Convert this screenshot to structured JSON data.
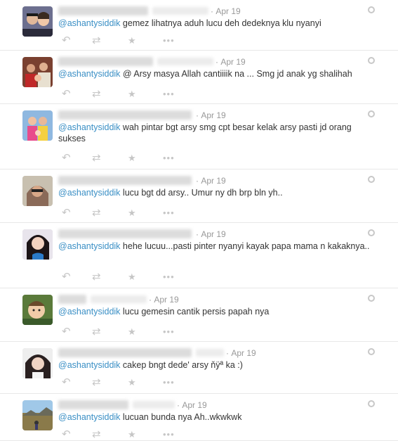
{
  "tweets": [
    {
      "date": "Apr 19",
      "mention": "@ashantysiddik",
      "text": " gemez lihatnya aduh lucu deh dedeknya klu nyanyi"
    },
    {
      "date": "Apr 19",
      "mention": "@ashantysiddik",
      "text": " @ Arsy masya Allah cantiiiik na ... Smg jd anak yg shalihah"
    },
    {
      "date": "Apr 19",
      "mention": "@ashantysiddik",
      "text": " wah pintar bgt arsy smg cpt besar kelak arsy pasti jd orang sukses"
    },
    {
      "date": "Apr 19",
      "mention": "@ashantysiddik",
      "text": " lucu bgt dd arsy.. Umur ny dh brp bln yh.."
    },
    {
      "date": "Apr 19",
      "mention": "@ashantysiddik",
      "text": " hehe lucuu...pasti pinter nyanyi kayak papa mama n kakaknya.."
    },
    {
      "date": "Apr 19",
      "mention": "@ashantysiddik",
      "text": " lucu gemesin cantik persis papah nya"
    },
    {
      "date": "Apr 19",
      "mention": "@ashantysiddik",
      "text": " cakep bngt dede' arsy  ňÿª  ka :)"
    },
    {
      "date": "Apr 19",
      "mention": "@ashantysiddik",
      "text": " lucuan bunda nya Ah..wkwkwk"
    }
  ],
  "icons": {
    "reply": "reply-icon",
    "retweet": "retweet-icon",
    "favorite": "star-icon",
    "more": "more-icon",
    "settings": "gear-icon"
  },
  "colors": {
    "mention": "#3a8fc5",
    "muted": "#999999",
    "action": "#c6c6c6",
    "divider": "#e8e8e8"
  }
}
